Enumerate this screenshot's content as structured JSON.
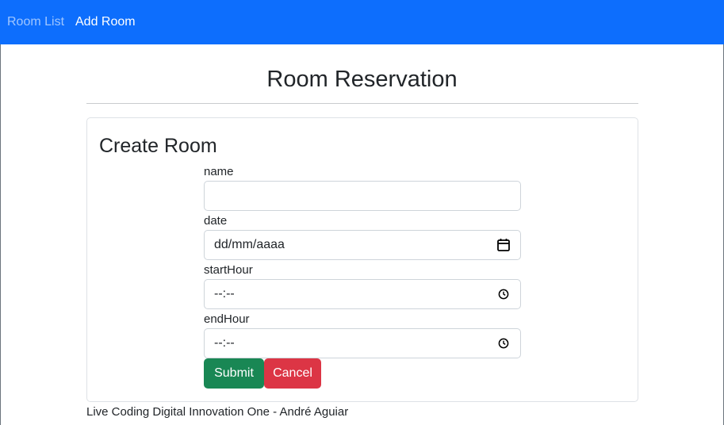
{
  "navbar": {
    "room_list_label": "Room List",
    "add_room_label": "Add Room",
    "background_color": "#0d6efd"
  },
  "page": {
    "title": "Room Reservation"
  },
  "card": {
    "title": "Create Room",
    "fields": [
      {
        "label": "name",
        "value": "",
        "type": "text"
      },
      {
        "label": "date",
        "value": "dd/mm/aaaa",
        "type": "date",
        "icon": "calendar-icon"
      },
      {
        "label": "startHour",
        "value": "--:--",
        "type": "time",
        "icon": "clock-icon"
      },
      {
        "label": "endHour",
        "value": "--:--",
        "type": "time",
        "icon": "clock-icon"
      }
    ],
    "submit_label": "Submit",
    "cancel_label": "Cancel",
    "submit_color": "#198754",
    "cancel_color": "#dc3545"
  },
  "footer": {
    "text": "Live Coding Digital Innovation One - André Aguiar"
  }
}
